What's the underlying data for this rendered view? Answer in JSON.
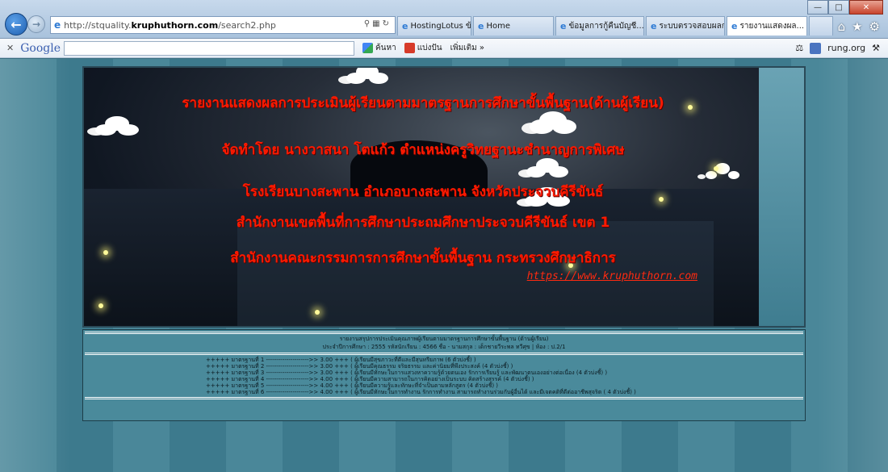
{
  "browser": {
    "address": {
      "url_prefix": "http://stquality.",
      "url_host": "kruphuthorn.com",
      "url_path": "/search2.php"
    },
    "tabs": [
      {
        "label": "HostingLotus ข้อมู...",
        "active": false
      },
      {
        "label": "Home",
        "active": false
      },
      {
        "label": "ข้อมูลการกู้คืนบัญชี...",
        "active": false
      },
      {
        "label": "ระบบตรวจสอบผลกา...",
        "active": false
      },
      {
        "label": "รายงานแสดงผล...",
        "active": true
      }
    ],
    "google_toolbar": {
      "logo": "Google",
      "search_label": "ค้นหา",
      "share_label": "แบ่งปัน",
      "more_label": "เพิ่มเติม »",
      "user_label": "rung.org"
    }
  },
  "banner": {
    "line1": "รายงานแสดงผลการประเมินผู้เรียนตามมาตรฐานการศึกษาขั้นพื้นฐาน(ด้านผู้เรียน)",
    "line2": "จัดทำโดย  นางวาสนา   โตแก้ว      ตำแหน่งครูวิทยฐานะชำนาญการพิเศษ",
    "line3": "โรงเรียนบางสะพาน  อำเภอบางสะพาน  จังหวัดประจวบคีรีขันธ์",
    "line4": "สำนักงานเขตพื้นที่การศึกษาประถมศึกษาประจวบคีรีขันธ์  เขต  1",
    "line5": "สำนักงานคณะกรรมการการศึกษาขั้นพื้นฐาน  กระทรวงศึกษาธิการ",
    "link": "https://www.kruphuthorn.com"
  },
  "report": {
    "title": "รายงานสรุปการประเมินคุณภาพผู้เรียนตามมาตรฐานการศึกษาขั้นพื้นฐาน (ด้านผู้เรียน)",
    "info": "ประจำปีการศึกษา : 2555  รหัสนักเรียน : 4566   ชื่อ - นามสกุล : เด็กชายวีระพล  ทวีศุข  |  ห้อง : ป.2/1",
    "standards": [
      "+++++ มาตรฐานที่ 1 --------------------->> 3.00 +++ ( ผู้เรียนมีสุขภาวะที่ดีและมีสุนทรียภาพ (6 ตัวบ่งชี้) )",
      "+++++ มาตรฐานที่ 2 --------------------->> 3.00 +++ ( ผู้เรียนมีคุณธรรม จริยธรรม และค่านิยมที่พึงประสงค์ (4 ตัวบ่งชี้) )",
      "+++++ มาตรฐานที่ 3 --------------------->> 3.00 +++ ( ผู้เรียนมีทักษะในการแสวงหาความรู้ด้วยตนเอง รักการเรียนรู้ และพัฒนาตนเองอย่างต่อเนื่อง (4 ตัวบ่งชี้) )",
      "+++++ มาตรฐานที่ 4 --------------------->> 4.00 +++ ( ผู้เรียนมีความสามารถในการคิดอย่างเป็นระบบ คิดสร้างสรรค์ (4 ตัวบ่งชี้) )",
      "+++++ มาตรฐานที่ 5 --------------------->> 4.00 +++ ( ผู้เรียนมีความรู้และทักษะที่จำเป็นตามหลักสูตร (4 ตัวบ่งชี้) )",
      "+++++ มาตรฐานที่ 6 --------------------->> 4.00 +++ ( ผู้เรียนมีทักษะในการทำงาน รักการทำงาน สามารถทำงานร่วมกับผู้อื่นได้ และมีเจตคติที่ดีต่ออาชีพสุจริต ( 4 ตัวบ่งชี้) )"
    ]
  }
}
